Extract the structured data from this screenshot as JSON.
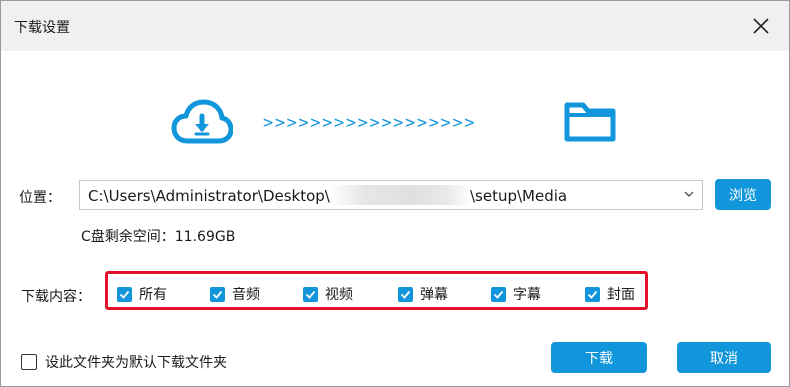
{
  "window": {
    "title": "下载设置"
  },
  "hero": {
    "arrows": ">>>>>>>>>>>>>>>>>>",
    "icons": [
      "cloud-download-icon",
      "folder-icon"
    ]
  },
  "location": {
    "label": "位置：",
    "path_prefix": "C:\\Users\\Administrator\\Desktop\\",
    "path_suffix": "\\setup\\Media",
    "browse_label": "浏览",
    "free_space": "C盘剩余空间：11.69GB"
  },
  "content": {
    "label": "下载内容：",
    "options": [
      {
        "label": "所有",
        "checked": true
      },
      {
        "label": "音频",
        "checked": true
      },
      {
        "label": "视频",
        "checked": true
      },
      {
        "label": "弹幕",
        "checked": true
      },
      {
        "label": "字幕",
        "checked": true
      },
      {
        "label": "封面",
        "checked": true
      }
    ]
  },
  "footer": {
    "default_folder_label": "设此文件夹为默认下载文件夹",
    "default_folder_checked": false,
    "download_label": "下载",
    "cancel_label": "取消"
  },
  "colors": {
    "accent": "#1296db",
    "highlight_border": "#e3122a",
    "titlebar": "#f0f0f0"
  }
}
